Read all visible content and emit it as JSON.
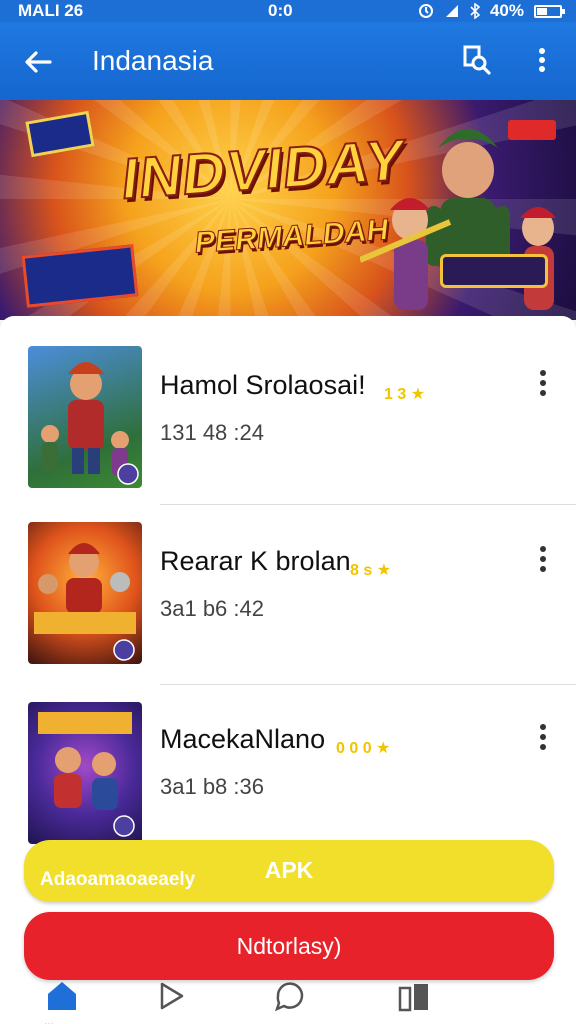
{
  "status_bar": {
    "time": "MALI 26",
    "center": "0:0",
    "battery": "40%",
    "battery_level": 0.4
  },
  "app_bar": {
    "title": "Indanasia",
    "back_icon": "arrow-left-icon",
    "search_icon": "search-icon",
    "more_icon": "more-vertical-icon"
  },
  "banner": {
    "headline": "INDVIDAY",
    "subhead": "PERMALDAH"
  },
  "games": [
    {
      "name": "Hamol Srolaosai!",
      "rating": "1 3",
      "meta": "131 48 :24"
    },
    {
      "name": "Rearar K brolan",
      "rating": "8 s",
      "meta": "3a1 b6 :42"
    },
    {
      "name": "MacekaNlano",
      "rating": "0 0 0",
      "meta": "3a1 b8 :36"
    }
  ],
  "buttons": {
    "apk_left": "Adaoamaoaeaely",
    "apk": "APK",
    "download": "Ndtorlasy)"
  },
  "bottom_nav": {
    "items": [
      "home-icon",
      "play-icon",
      "chat-icon",
      "library-icon"
    ],
    "home_label": "..."
  },
  "colors": {
    "primary": "#1f79e0",
    "apk_button": "#f1df2c",
    "download_button": "#e8222a",
    "star": "#f1c400"
  }
}
